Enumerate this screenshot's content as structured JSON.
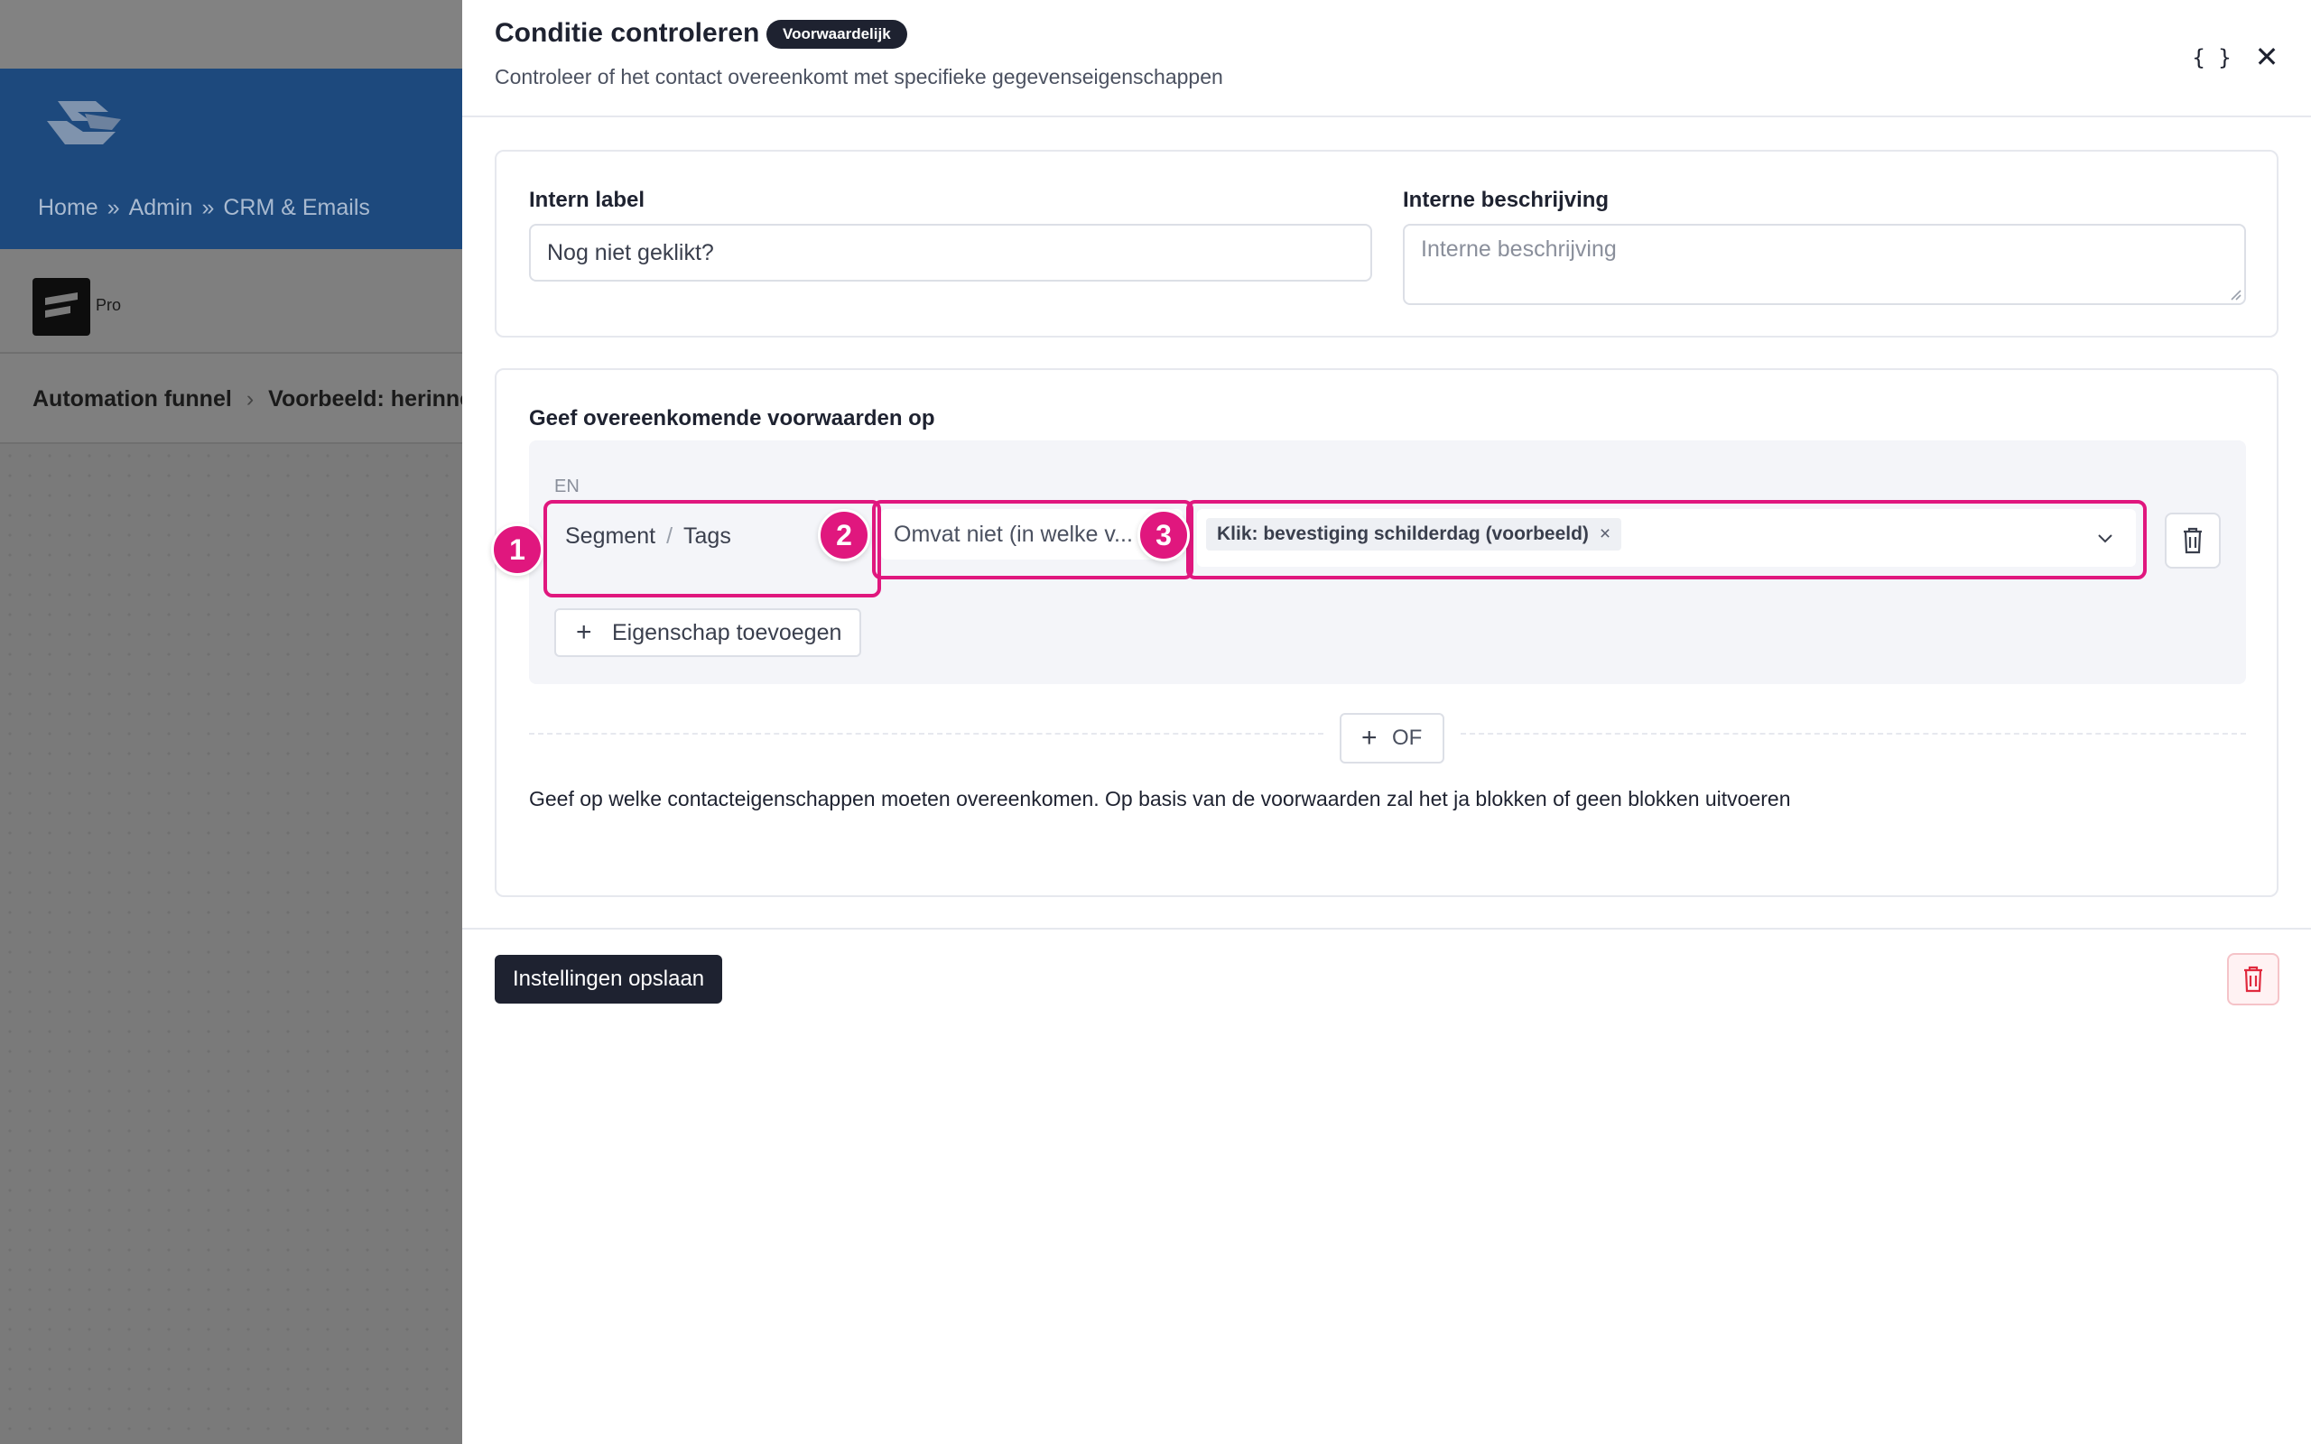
{
  "background": {
    "breadcrumb": [
      "Home",
      "Admin",
      "CRM & Emails"
    ],
    "breadcrumb_sep": "»",
    "pro_label": "Pro",
    "crumbs": [
      "Automation funnel",
      "Voorbeeld: herinner"
    ]
  },
  "drawer": {
    "title": "Conditie controleren",
    "badge": "Voorwaardelijk",
    "subtitle": "Controleer of het contact overeenkomt met specifieke gegevenseigenschappen",
    "code_label": "{ }",
    "close_label": "✕"
  },
  "form": {
    "intern_label": {
      "label": "Intern label",
      "value": "Nog niet geklikt?"
    },
    "intern_desc": {
      "label": "Interne beschrijving",
      "placeholder": "Interne beschrijving"
    }
  },
  "conditions": {
    "heading": "Geef overeenkomende voorwaarden op",
    "group_label": "EN",
    "rule": {
      "segment": "Segment",
      "slash": "/",
      "property": "Tags",
      "operator": "Omvat niet (in welke v...",
      "tag": "Klik: bevestiging schilderdag (voorbeeld)",
      "tag_remove": "×"
    },
    "markers": [
      "1",
      "2",
      "3"
    ],
    "add_property": "Eigenschap toevoegen",
    "or_label": "OF",
    "hint": "Geef op welke contacteigenschappen moeten overeenkomen. Op basis van de voorwaarden zal het ja blokken of geen blokken uitvoeren"
  },
  "footer": {
    "save": "Instellingen opslaan"
  },
  "colors": {
    "highlight": "#e0177e",
    "dark": "#1e2230",
    "header_blue": "#1d497d",
    "danger": "#e0293d"
  }
}
